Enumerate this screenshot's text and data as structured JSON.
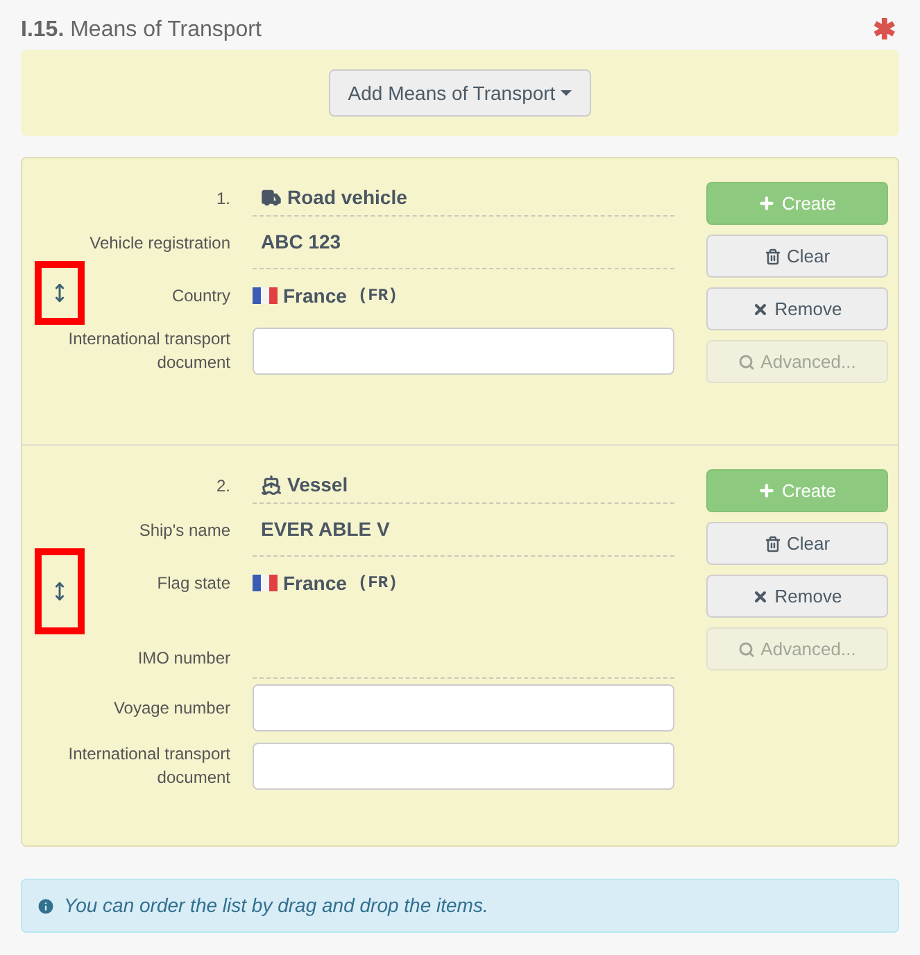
{
  "section": {
    "number": "I.15.",
    "title": "Means of Transport",
    "required_mark": "✱"
  },
  "add_button": {
    "label": "Add Means of Transport"
  },
  "items": [
    {
      "index": "1.",
      "kind": "road",
      "type_label": "Road vehicle",
      "handle_highlighted": true,
      "fields": [
        {
          "kind": "text",
          "label": "Vehicle registration",
          "value": "ABC 123"
        },
        {
          "kind": "country",
          "label": "Country",
          "value": "France",
          "code": "(FR)"
        },
        {
          "kind": "input",
          "label": "International transport document"
        }
      ],
      "buttons": [
        {
          "kind": "create",
          "label": "Create",
          "disabled": false
        },
        {
          "kind": "clear",
          "label": "Clear",
          "disabled": false
        },
        {
          "kind": "remove",
          "label": "Remove",
          "disabled": false
        },
        {
          "kind": "advanced",
          "label": "Advanced...",
          "disabled": true
        }
      ]
    },
    {
      "index": "2.",
      "kind": "vessel",
      "type_label": "Vessel",
      "handle_highlighted": true,
      "fields": [
        {
          "kind": "text",
          "label": "Ship's name",
          "value": "EVER ABLE V"
        },
        {
          "kind": "country",
          "label": "Flag state",
          "value": "France",
          "code": "(FR)"
        },
        {
          "kind": "empty",
          "label": "IMO number"
        },
        {
          "kind": "input",
          "label": "Voyage number"
        },
        {
          "kind": "input",
          "label": "International transport document"
        }
      ],
      "buttons": [
        {
          "kind": "create",
          "label": "Create",
          "disabled": false
        },
        {
          "kind": "clear",
          "label": "Clear",
          "disabled": false
        },
        {
          "kind": "remove",
          "label": "Remove",
          "disabled": false
        },
        {
          "kind": "advanced",
          "label": "Advanced...",
          "disabled": true
        }
      ]
    }
  ],
  "info": {
    "text": "You can order the list by drag and drop the items."
  }
}
